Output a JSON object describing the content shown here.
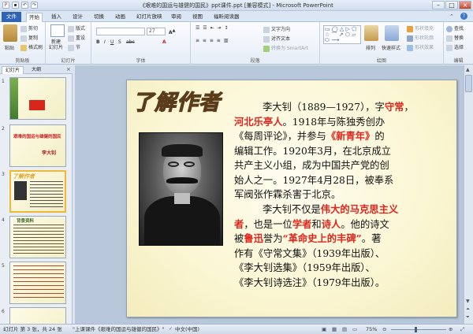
{
  "window": {
    "title": "《艰难的国运与雄健的国民》ppt课件.ppt [兼容模式] - Microsoft PowerPoint"
  },
  "ribbon_tabs": [
    {
      "label": "文件"
    },
    {
      "label": "开始"
    },
    {
      "label": "插入"
    },
    {
      "label": "设计"
    },
    {
      "label": "切换"
    },
    {
      "label": "动画"
    },
    {
      "label": "幻灯片放映"
    },
    {
      "label": "审阅"
    },
    {
      "label": "视图"
    },
    {
      "label": "福昕阅读器"
    }
  ],
  "clipboard": {
    "paste": "粘贴",
    "cut": "剪切",
    "copy": "复制",
    "format_painter": "格式刷",
    "label": "剪贴板"
  },
  "slides_group": {
    "new_slide": "新建\n幻灯片",
    "layout": "版式",
    "reset": "重设",
    "section": "节",
    "label": "幻灯片"
  },
  "font_group": {
    "size": "27",
    "label": "字体"
  },
  "paragraph_group": {
    "text_direction": "文字方向",
    "align_text": "对齐文本",
    "smartart": "转换为 SmartArt",
    "label": "段落"
  },
  "drawing_group": {
    "arrange": "排列",
    "quick_styles": "快速样式",
    "shape_fill": "形状填充",
    "shape_outline": "形状轮廓",
    "shape_effects": "形状效果",
    "label": "绘图"
  },
  "editing_group": {
    "find": "查找",
    "replace": "替换",
    "select": "选择",
    "label": "编辑"
  },
  "panel_tabs": {
    "slides": "幻灯片",
    "outline": "大纲"
  },
  "thumbnails": [
    {
      "num": "1"
    },
    {
      "num": "2",
      "title": "艰难的国运与雄健的国民",
      "author": "李大钊"
    },
    {
      "num": "3",
      "title": "了解作者"
    },
    {
      "num": "4",
      "title": "背景资料"
    },
    {
      "num": "5"
    },
    {
      "num": "6"
    }
  ],
  "slide": {
    "title": "了解作者",
    "para1_lines": [
      [
        "李大钊（1889—1927），字",
        "守常",
        "，"
      ],
      [
        "河北乐亭人",
        "。1918年与陈独秀创办"
      ],
      [
        "《每周评论》，并参与",
        "《新青年》",
        "的"
      ],
      [
        "编辑工作。1920年3月，在北京成立"
      ],
      [
        "共产主义小组，成为中国共产党的创"
      ],
      [
        "始人之一。1927年4月28日，被奉系"
      ],
      [
        "军阀张作霖杀害于北京。"
      ]
    ],
    "para2_lines": [
      [
        "李大钊不仅是",
        "伟大的马克思主义"
      ],
      [
        "者",
        "，也是一位",
        "学者",
        "和",
        "诗人",
        "。他的诗文"
      ],
      [
        "被",
        "鲁迅",
        "誉为",
        "“革命史上的丰碑”",
        "。著"
      ],
      [
        "作有《守常文集》（1939年出版）、"
      ],
      [
        "《李大钊选集》（1959年出版）、"
      ],
      [
        "《李大钊诗选注》（1979年出版）。"
      ]
    ]
  },
  "statusbar": {
    "slide_info": "幻灯片 第 3 张，共 24 张",
    "theme": "\"上课课件《艰难的国运与雄健的国民》\"",
    "language": "中文(中国)",
    "zoom": "75%"
  },
  "colors": {
    "accent_red": "#e0251c",
    "file_tab": "#2f64b5",
    "title_gold": "#f6c23c"
  }
}
